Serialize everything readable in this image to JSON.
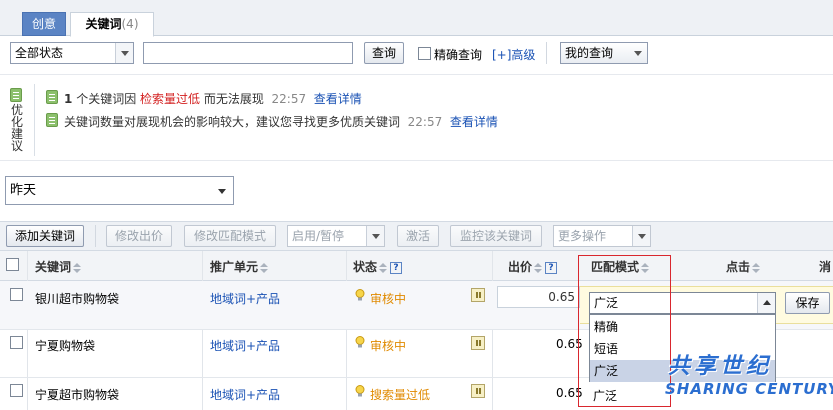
{
  "tabs": [
    {
      "label": "创意"
    },
    {
      "label": "关键词",
      "count": "(4)"
    }
  ],
  "filter": {
    "status_select": "全部状态",
    "search_value": "",
    "search_button": "查询",
    "exact_label": "精确查询",
    "advanced_link": "[+]高级",
    "my_query": "我的查询"
  },
  "suggestions": {
    "panel_label": "优化建议",
    "items": [
      {
        "count": "1",
        "text_a": "个关键词因",
        "highlight": "检索量过低",
        "text_b": "而无法展现",
        "time": "22:57",
        "link": "查看详情"
      },
      {
        "text_a": "关键词数量对展现机会的影响较大，建议您寻找更多优质关键词",
        "time": "22:57",
        "link": "查看详情"
      }
    ]
  },
  "date_select": "昨天",
  "toolbar": {
    "add_keyword": "添加关键词",
    "edit_price": "修改出价",
    "edit_match": "修改匹配模式",
    "enable_pause": "启用/暂停",
    "activate": "激活",
    "monitor": "监控该关键词",
    "more": "更多操作"
  },
  "table": {
    "headers": {
      "keyword": "关键词",
      "unit": "推广单元",
      "status": "状态",
      "price": "出价",
      "match": "匹配模式",
      "clicks": "点击",
      "cost": "消"
    },
    "rows": [
      {
        "keyword": "银川超市购物袋",
        "unit": "地域词+产品",
        "status": "审核中",
        "price": "0.65"
      },
      {
        "keyword": "宁夏购物袋",
        "unit": "地域词+产品",
        "status": "审核中",
        "price": "0.65"
      },
      {
        "keyword": "宁夏超市购物袋",
        "unit": "地域词+产品",
        "status": "搜索量过低",
        "price": "0.65"
      }
    ]
  },
  "match_editor": {
    "selected": "广泛",
    "options": [
      "精确",
      "短语",
      "广泛"
    ],
    "save_button": "保存",
    "row4_match": "广泛"
  },
  "watermark": {
    "cn": "共享世纪",
    "en": "SHARING CENTURY"
  },
  "colors": {
    "accent": "#5b84c4",
    "link": "#1a52b4",
    "warning": "#e08a00",
    "alert": "#d31f1f",
    "highlight_box": "#d9272e"
  }
}
